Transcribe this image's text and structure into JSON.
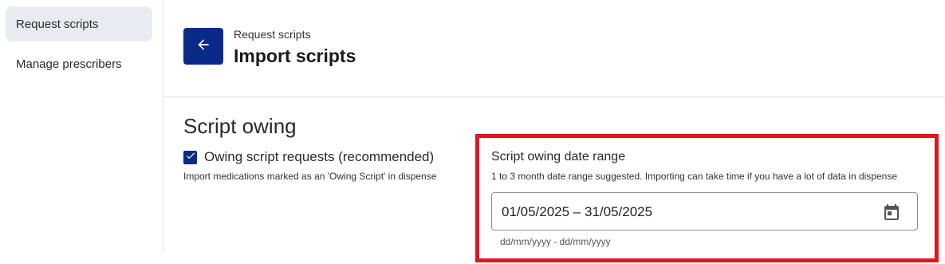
{
  "sidebar": {
    "items": [
      {
        "label": "Request scripts",
        "active": true
      },
      {
        "label": "Manage prescribers",
        "active": false
      }
    ]
  },
  "header": {
    "back_icon": "arrow-left-icon",
    "breadcrumb": "Request scripts",
    "title": "Import scripts"
  },
  "main": {
    "section_title": "Script owing",
    "owing": {
      "checked": true,
      "label": "Owing script requests (recommended)",
      "help": "Import medications marked as an 'Owing Script' in dispense"
    },
    "date_range": {
      "title": "Script owing date range",
      "help": "1 to 3 month date range suggested. Importing can take time if you have a lot of data in dispense",
      "value": "01/05/2025 – 31/05/2025",
      "format_hint": "dd/mm/yyyy - dd/mm/yyyy",
      "calendar_icon": "calendar-icon"
    }
  },
  "colors": {
    "primary": "#0a2a8a",
    "active_nav_bg": "#e8ebf2",
    "highlight_border": "#e0161e"
  }
}
